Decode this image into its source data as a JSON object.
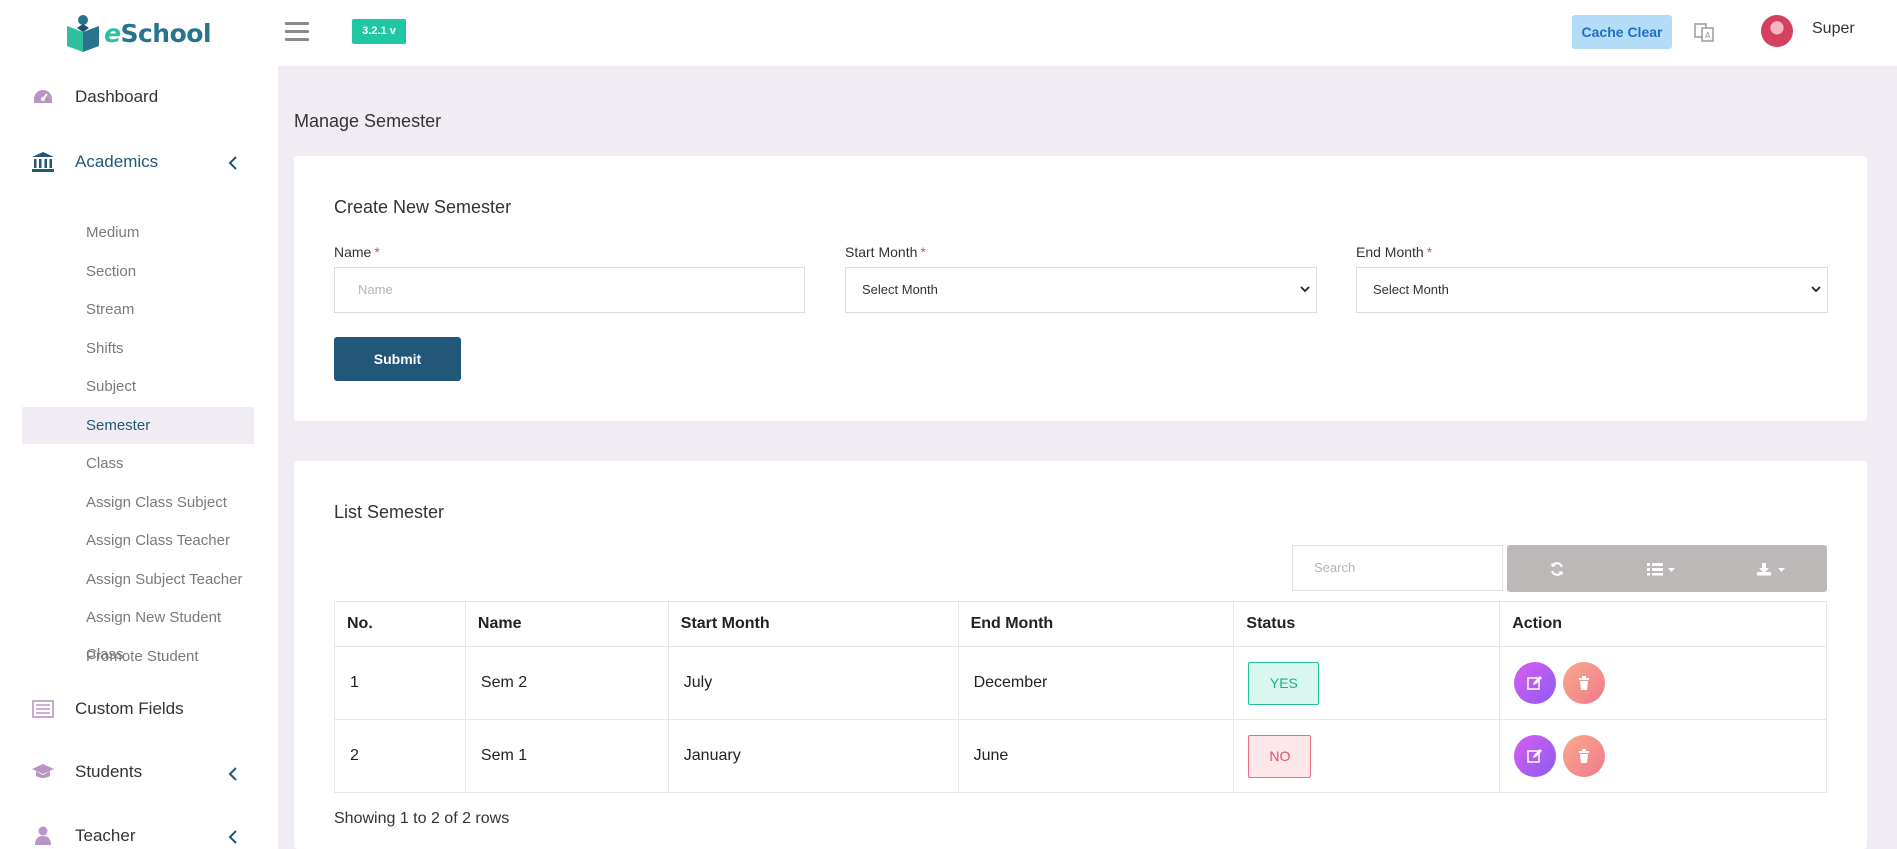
{
  "header": {
    "logo_text_e": "e",
    "logo_text_rest": "School",
    "version": "3.2.1 v",
    "cache_clear": "Cache Clear",
    "user_name": "Super"
  },
  "sidebar": {
    "dashboard": "Dashboard",
    "academics": "Academics",
    "academics_items": [
      "Medium",
      "Section",
      "Stream",
      "Shifts",
      "Subject",
      "Semester",
      "Class",
      "Assign Class Subject",
      "Assign Class Teacher",
      "Assign Subject Teacher",
      "Assign New Student Class",
      "Promote Student"
    ],
    "active_item": "Semester",
    "custom_fields": "Custom Fields",
    "students": "Students",
    "teacher": "Teacher"
  },
  "page": {
    "title": "Manage Semester"
  },
  "form": {
    "title": "Create New Semester",
    "name_label": "Name",
    "name_placeholder": "Name",
    "start_label": "Start Month",
    "start_value": "Select Month",
    "end_label": "End Month",
    "end_value": "Select Month",
    "required_mark": "*",
    "submit": "Submit"
  },
  "list": {
    "title": "List Semester",
    "search_placeholder": "Search",
    "columns": [
      "No.",
      "Name",
      "Start Month",
      "End Month",
      "Status",
      "Action"
    ],
    "rows": [
      {
        "no": "1",
        "name": "Sem 2",
        "start": "July",
        "end": "December",
        "status": "YES"
      },
      {
        "no": "2",
        "name": "Sem 1",
        "start": "January",
        "end": "June",
        "status": "NO"
      }
    ],
    "showing": "Showing 1 to 2 of 2 rows"
  },
  "colors": {
    "primary": "#22577a",
    "accent": "#1fc7a3",
    "status_yes": "#1fae8b",
    "status_no": "#e2506a",
    "background": "#f1ecf3"
  }
}
